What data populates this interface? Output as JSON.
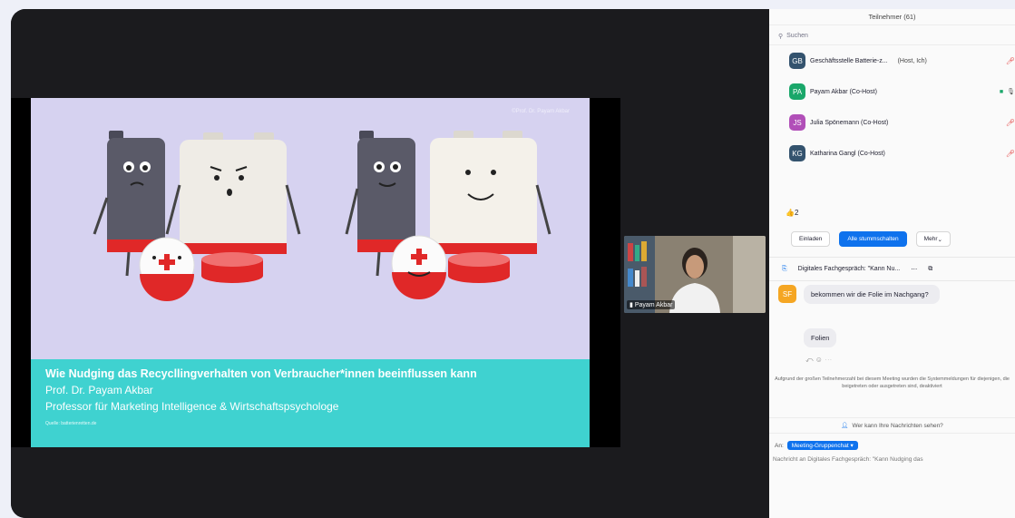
{
  "slide": {
    "copyright": "©Prof. Dr. Payam Akbar",
    "title": "Wie Nudging das Recycllingverhalten von Verbraucher*innen beeinflussen kann",
    "line1": "Prof. Dr. Payam Akbar",
    "line2": "Professor für Marketing Intelligence & Wirtschaftspsychologe",
    "source": "Quelle: batterienretten.de"
  },
  "video": {
    "name": "Payam Akbar"
  },
  "participants": {
    "title": "Teilnehmer (61)",
    "search_placeholder": "Suchen",
    "items": [
      {
        "initials": "GB",
        "name": "Geschäftsstelle Batterie-z...",
        "role": "(Host, Ich)",
        "color": "#34536e"
      },
      {
        "initials": "PA",
        "name": "Payam Akbar (Co-Host)",
        "role": "",
        "color": "#1aa76a"
      },
      {
        "initials": "JS",
        "name": "Julia Spönemann (Co-Host)",
        "role": "",
        "color": "#b14fb8"
      },
      {
        "initials": "KG",
        "name": "Katharina Gangl (Co-Host)",
        "role": "",
        "color": "#34536e"
      }
    ],
    "reactions": "2",
    "invite_label": "Einladen",
    "mute_all_label": "Alle stummschalten",
    "more_label": "Mehr"
  },
  "chat": {
    "title": "Digitales Fachgespräch: \"Kann Nu...",
    "sender_initials": "SF",
    "sender_color": "#f5a623",
    "message1": "bekommen wir die Folie im Nachgang?",
    "message2": "Folien",
    "notice": "Aufgrund der großen Teilnehmerzahl bei diesem Meeting wurden die Systemmeldungen für diejenigen, die beigetreten oder ausgetreten sind, deaktiviert",
    "who_can_see": "Wer kann Ihre Nachrichten sehen?",
    "to_label": "An:",
    "recipient": "Meeting-Gruppenchat",
    "input_placeholder": "Nachricht an Digitales Fachgespräch: \"Kann Nudging das"
  }
}
